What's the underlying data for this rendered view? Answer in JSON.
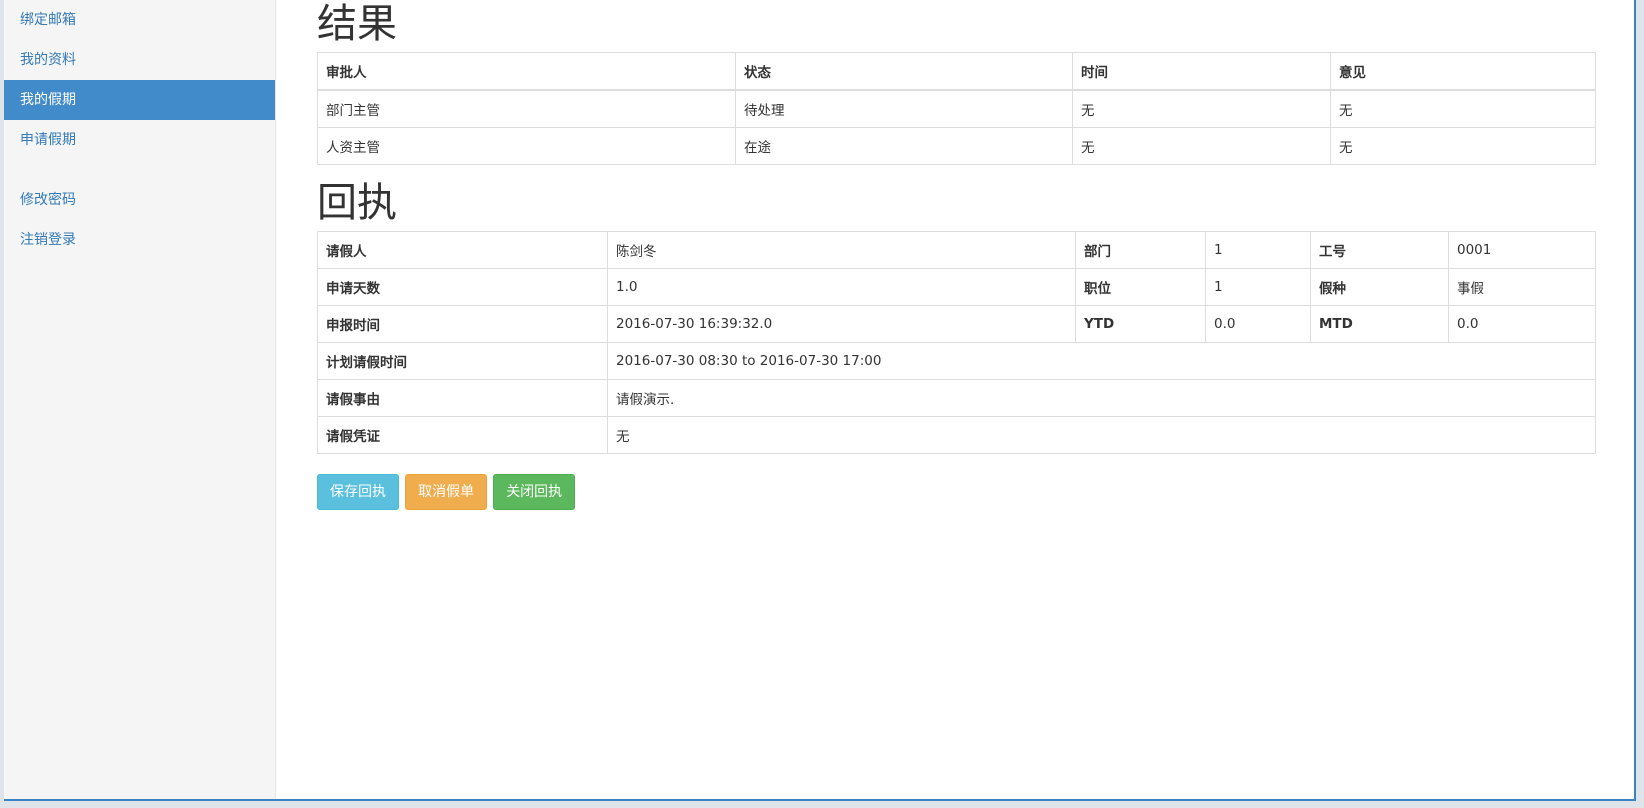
{
  "sidebar": {
    "items": [
      {
        "label": "绑定邮箱"
      },
      {
        "label": "我的资料"
      },
      {
        "label": "我的假期"
      },
      {
        "label": "申请假期"
      },
      {
        "label": "修改密码"
      },
      {
        "label": "注销登录"
      }
    ]
  },
  "results": {
    "title": "结果",
    "headers": [
      "审批人",
      "状态",
      "时间",
      "意见"
    ],
    "rows": [
      [
        "部门主管",
        "待处理",
        "无",
        "无"
      ],
      [
        "人资主管",
        "在途",
        "无",
        "无"
      ]
    ]
  },
  "receipt": {
    "title": "回执",
    "applicant_label": "请假人",
    "applicant": "陈剑冬",
    "dept_label": "部门",
    "dept": "1",
    "empno_label": "工号",
    "empno": "0001",
    "days_label": "申请天数",
    "days": "1.0",
    "position_label": "职位",
    "position": "1",
    "type_label": "假种",
    "type": "事假",
    "submit_label": "申报时间",
    "submit": "2016-07-30 16:39:32.0",
    "ytd_label": "YTD",
    "ytd": "0.0",
    "mtd_label": "MTD",
    "mtd": "0.0",
    "plan_label": "计划请假时间",
    "plan": "2016-07-30 08:30 to 2016-07-30 17:00",
    "reason_label": "请假事由",
    "reason": "请假演示.",
    "proof_label": "请假凭证",
    "proof": "无"
  },
  "buttons": {
    "save": "保存回执",
    "cancel": "取消假单",
    "close": "关闭回执"
  },
  "colors": {
    "active_nav": "#428bca",
    "info": "#5bc0de",
    "warning": "#f0ad4e",
    "success": "#5cb85c"
  }
}
